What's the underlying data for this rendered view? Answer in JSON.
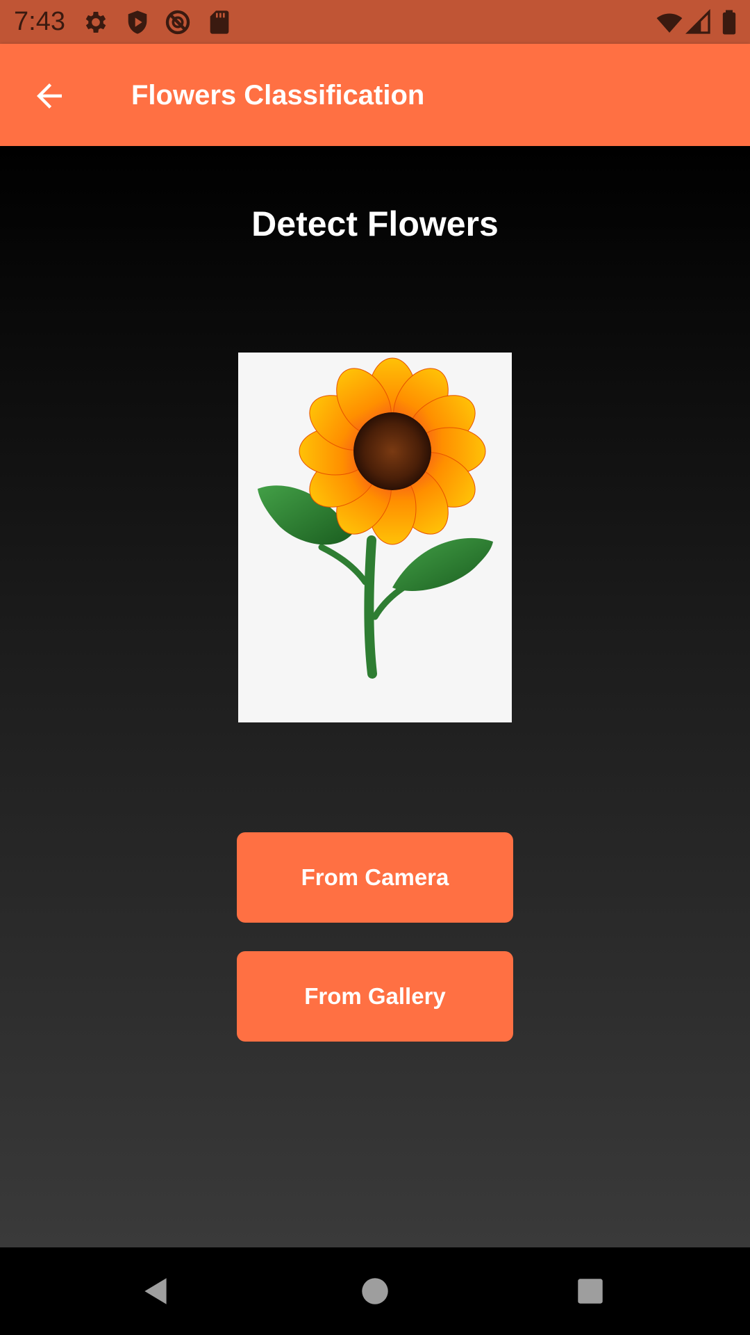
{
  "status_bar": {
    "time": "7:43",
    "left_icons": [
      "gear-icon",
      "shield-icon",
      "no-sync-icon",
      "sd-card-icon"
    ],
    "right_icons": [
      "wifi-icon",
      "signal-icon",
      "battery-icon"
    ]
  },
  "app_bar": {
    "title": "Flowers Classification",
    "back_icon": "arrow-back-icon"
  },
  "main": {
    "heading": "Detect Flowers",
    "image": "sunflower-illustration",
    "buttons": {
      "camera": "From Camera",
      "gallery": "From Gallery"
    }
  },
  "nav_bar": {
    "icons": [
      "back-triangle-icon",
      "home-circle-icon",
      "recents-square-icon"
    ]
  },
  "colors": {
    "accent": "#ff7043",
    "status_bar": "#c05535",
    "background_top": "#000000",
    "background_bottom": "#3a3a3a"
  }
}
